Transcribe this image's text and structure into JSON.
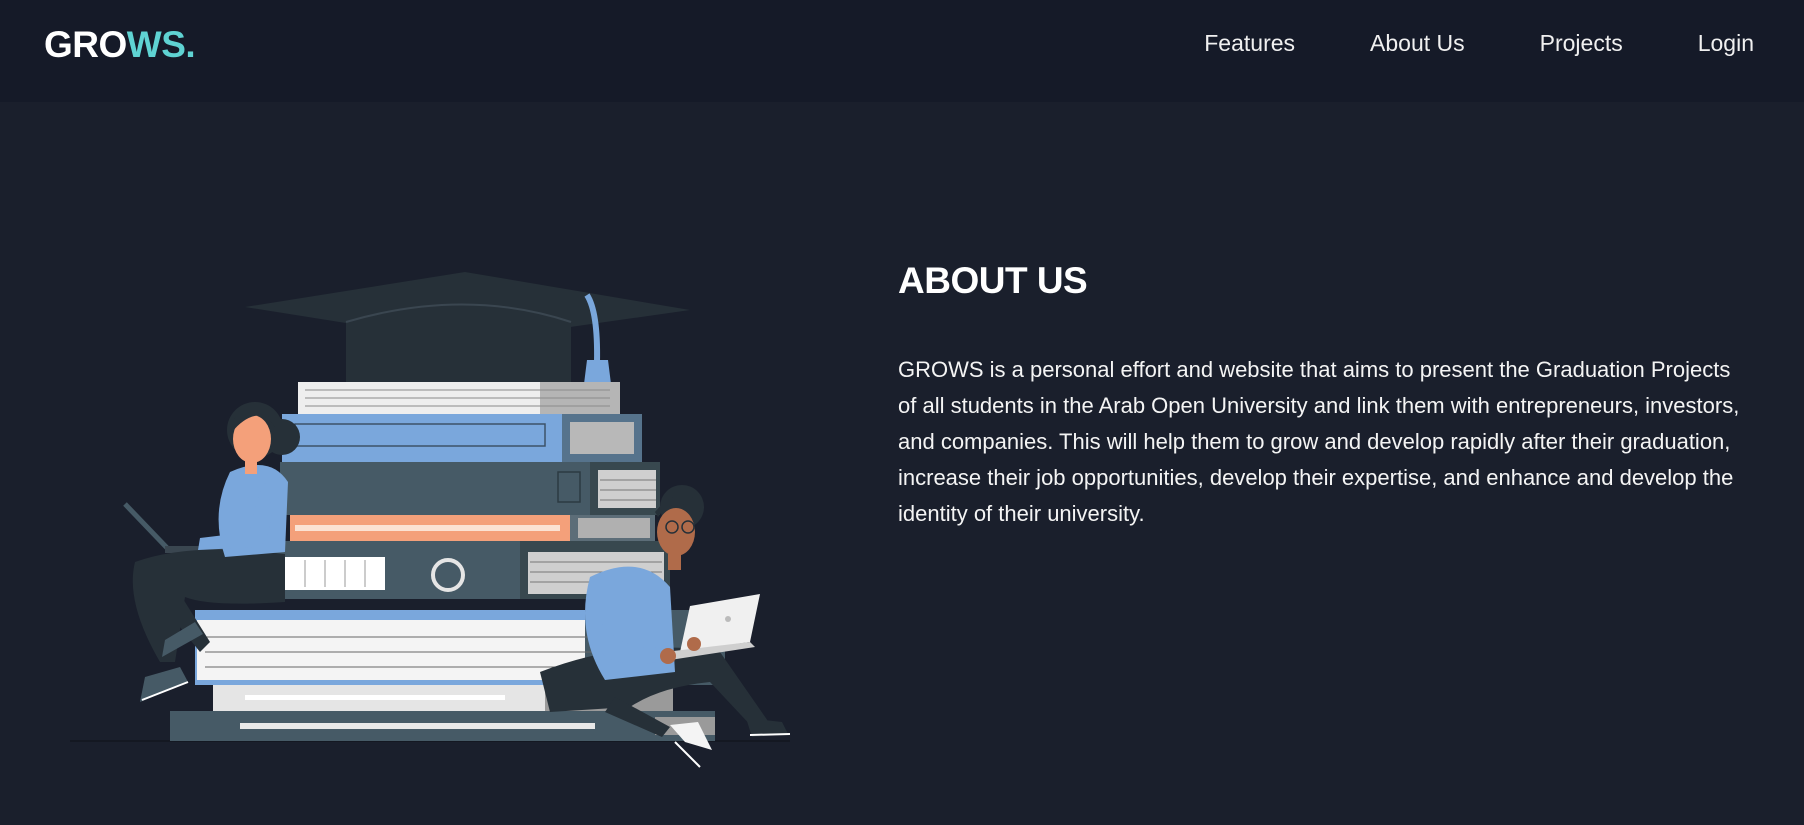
{
  "navbar": {
    "logo_white": "GRO",
    "logo_accent": "WS.",
    "links": [
      "Features",
      "About Us",
      "Projects",
      "Login"
    ]
  },
  "about": {
    "title": "ABOUT US",
    "body": "GROWS is a personal effort and website that aims to present the Graduation Projects of all students in the Arab Open University and link them with entrepreneurs, investors, and companies. This will help them to grow and develop rapidly after their graduation, increase their job opportunities, develop their expertise, and enhance and develop the identity of their university."
  },
  "colors": {
    "background": "#1a1f2c",
    "navbar": "#151a28",
    "accent": "#5fd3d3",
    "book_blue": "#7aa7dc",
    "book_dark": "#465a66",
    "book_orange": "#f4a07a"
  },
  "illustration": {
    "icon": "students-on-books-illustration"
  }
}
